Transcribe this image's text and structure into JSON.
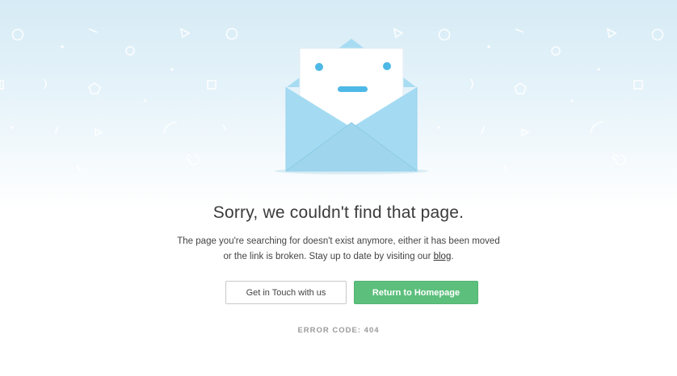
{
  "title": "Sorry, we couldn't find that page.",
  "description": {
    "text": "The page you're searching for doesn't exist anymore, either it has been moved or the link is broken. Stay up to date by visiting our ",
    "link_label": "blog",
    "end": "."
  },
  "buttons": {
    "contact_label": "Get in Touch with us",
    "home_label": "Return to Homepage"
  },
  "error_code": "ERROR CODE: 404",
  "colors": {
    "accent_green": "#5cbf7c",
    "envelope_blue": "#a7dcf2",
    "face_blue": "#4eb8e6"
  },
  "icons": {
    "illustration": "sad-envelope-icon"
  }
}
